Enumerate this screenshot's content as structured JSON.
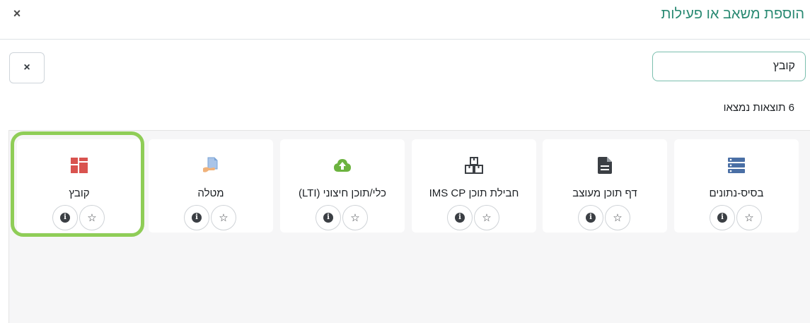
{
  "modal": {
    "title": "הוספת משאב או פעילות",
    "close_label": "×"
  },
  "search": {
    "value": "קובץ",
    "clear_label": "×"
  },
  "results": {
    "count_text": "6 תוצאות נמצאו"
  },
  "cards": [
    {
      "label": "בסיס-נתונים",
      "icon": "database-list-icon",
      "icon_color": "#4a6fa5"
    },
    {
      "label": "דף תוכן מעוצב",
      "icon": "document-page-icon",
      "icon_color": "#3b3f44"
    },
    {
      "label": "חבילת תוכן IMS CP",
      "icon": "boxes-package-icon",
      "icon_color": "#3b3f44"
    },
    {
      "label": "כלי/תוכן חיצוני (LTI)",
      "icon": "upload-puzzle-icon",
      "icon_color": "#6cb33f"
    },
    {
      "label": "מטלה",
      "icon": "assignment-hand-icon",
      "icon_color": "#7aa3d6"
    },
    {
      "label": "קובץ",
      "icon": "file-blocks-icon",
      "icon_color": "#d9534f"
    }
  ],
  "highlight_color": "#8fcd57",
  "accent_color": "#2a8a73"
}
